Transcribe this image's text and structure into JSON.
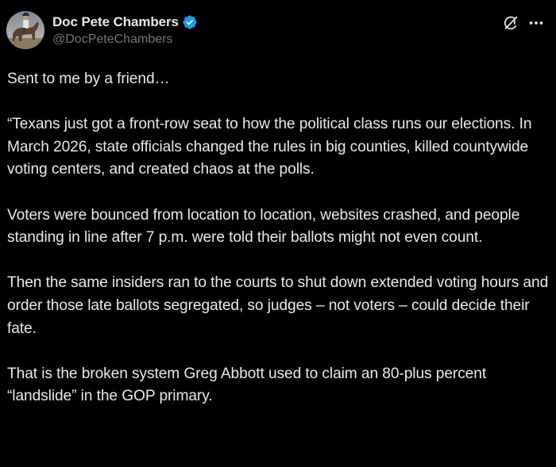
{
  "author": {
    "display_name": "Doc Pete Chambers",
    "handle": "@DocPeteChambers",
    "verified": true,
    "avatar_icon": "profile-photo-rider-on-horse"
  },
  "actions": {
    "grok_icon": "grok-icon",
    "more_icon": "more-options-icon"
  },
  "tweet": {
    "text": "Sent to me by a friend…\n\n“Texans just got a front-row seat to how the political class runs our elections. In March 2026, state officials changed the rules in big counties, killed countywide voting centers, and created chaos at the polls.\n\nVoters were bounced from location to location, websites crashed, and people standing in line after 7 p.m. were told their ballots might not even count.\n\nThen the same insiders ran to the courts to shut down extended voting hours and order those late ballots segregated, so judges – not voters – could decide their fate.\n\nThat is the broken system Greg Abbott used to claim an 80-plus percent “landslide” in the GOP primary."
  },
  "colors": {
    "background": "#000000",
    "text_primary": "#e7e9ea",
    "text_secondary": "#71767b",
    "verified_blue": "#1d9bf0"
  }
}
